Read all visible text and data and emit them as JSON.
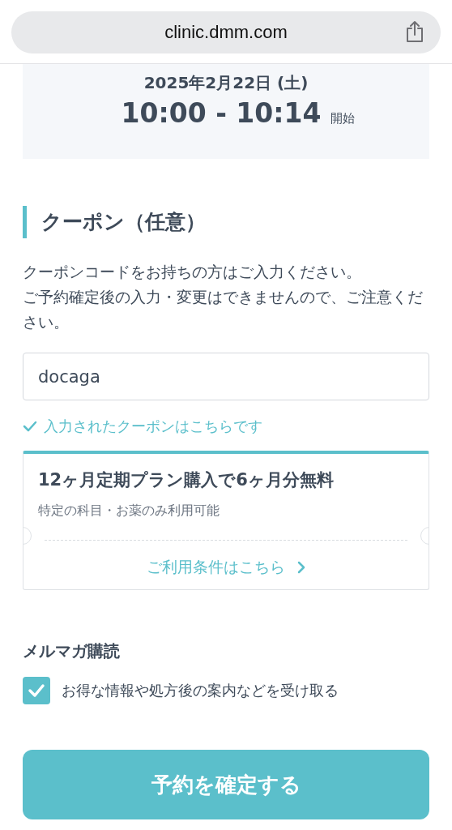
{
  "address_bar": {
    "url": "clinic.dmm.com"
  },
  "appointment": {
    "date": "2025年2月22日 (土)",
    "time_range": "10:00 - 10:14",
    "time_suffix": "開始"
  },
  "coupon": {
    "title": "クーポン（任意）",
    "description": [
      "クーポンコードをお持ちの方はご入力ください。",
      "ご予約確定後の入力・変更はできませんので、ご注意ください。"
    ],
    "input": {
      "value": "docaga"
    },
    "status": "入力されたクーポンはこちらです",
    "card": {
      "title": "12ヶ月定期プラン購入で6ヶ月分無料",
      "note": "特定の科目・お薬のみ利用可能",
      "link": "ご利用条件はこちら"
    }
  },
  "newsletter": {
    "title": "メルマガ購読",
    "checkbox": {
      "label": "お得な情報や処方後の案内などを受け取る",
      "checked": true
    }
  },
  "submit_button": {
    "label": "予約を確定する"
  }
}
